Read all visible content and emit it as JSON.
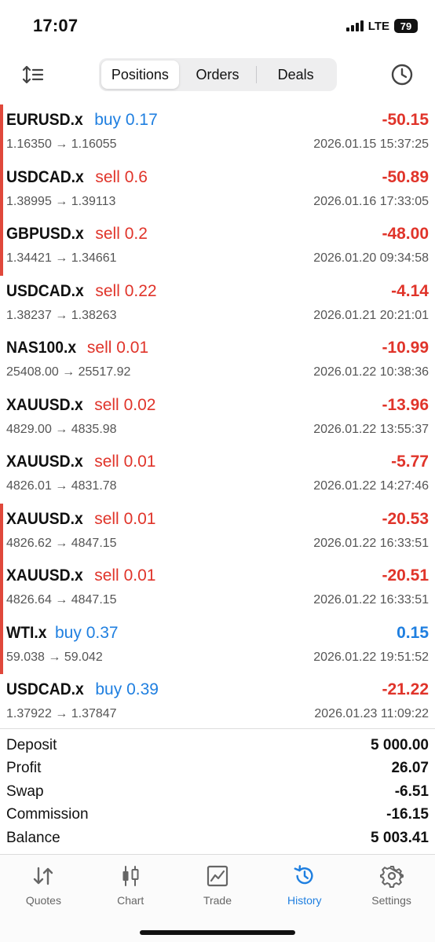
{
  "status": {
    "time": "17:07",
    "network": "LTE",
    "battery": "79"
  },
  "tabs_top": {
    "positions": "Positions",
    "orders": "Orders",
    "deals": "Deals",
    "active": "Positions"
  },
  "trades": [
    {
      "symbol": "EURUSD.x",
      "side": "buy",
      "volume": "0.17",
      "prices": "1.16350 → 1.16055",
      "datetime": "2026.01.15 15:37:25",
      "profit": "-50.15"
    },
    {
      "symbol": "USDCAD.x",
      "side": "sell",
      "volume": "0.6",
      "prices": "1.38995 → 1.39113",
      "datetime": "2026.01.16 17:33:05",
      "profit": "-50.89"
    },
    {
      "symbol": "GBPUSD.x",
      "side": "sell",
      "volume": "0.2",
      "prices": "1.34421 → 1.34661",
      "datetime": "2026.01.20 09:34:58",
      "profit": "-48.00"
    },
    {
      "symbol": "USDCAD.x",
      "side": "sell",
      "volume": "0.22",
      "prices": "1.38237 → 1.38263",
      "datetime": "2026.01.21 20:21:01",
      "profit": "-4.14"
    },
    {
      "symbol": "NAS100.x",
      "side": "sell",
      "volume": "0.01",
      "prices": "25408.00 → 25517.92",
      "datetime": "2026.01.22 10:38:36",
      "profit": "-10.99"
    },
    {
      "symbol": "XAUUSD.x",
      "side": "sell",
      "volume": "0.02",
      "prices": "4829.00 → 4835.98",
      "datetime": "2026.01.22 13:55:37",
      "profit": "-13.96"
    },
    {
      "symbol": "XAUUSD.x",
      "side": "sell",
      "volume": "0.01",
      "prices": "4826.01 → 4831.78",
      "datetime": "2026.01.22 14:27:46",
      "profit": "-5.77"
    },
    {
      "symbol": "XAUUSD.x",
      "side": "sell",
      "volume": "0.01",
      "prices": "4826.62 → 4847.15",
      "datetime": "2026.01.22 16:33:51",
      "profit": "-20.53"
    },
    {
      "symbol": "XAUUSD.x",
      "side": "sell",
      "volume": "0.01",
      "prices": "4826.64 → 4847.15",
      "datetime": "2026.01.22 16:33:51",
      "profit": "-20.51"
    },
    {
      "symbol": "WTI.x",
      "side": "buy",
      "volume": "0.37",
      "prices": "59.038 → 59.042",
      "datetime": "2026.01.22 19:51:52",
      "profit": "0.15"
    },
    {
      "symbol": "USDCAD.x",
      "side": "buy",
      "volume": "0.39",
      "prices": "1.37922 → 1.37847",
      "datetime": "2026.01.23 11:09:22",
      "profit": "-21.22"
    }
  ],
  "summary": [
    {
      "label": "Deposit",
      "value": "5 000.00"
    },
    {
      "label": "Profit",
      "value": "26.07"
    },
    {
      "label": "Swap",
      "value": "-6.51"
    },
    {
      "label": "Commission",
      "value": "-16.15"
    },
    {
      "label": "Balance",
      "value": "5 003.41"
    }
  ],
  "bottom_tabs": [
    {
      "label": "Quotes",
      "icon": "quotes-icon"
    },
    {
      "label": "Chart",
      "icon": "chart-icon"
    },
    {
      "label": "Trade",
      "icon": "trade-icon"
    },
    {
      "label": "History",
      "icon": "history-icon",
      "active": true
    },
    {
      "label": "Settings",
      "icon": "settings-icon"
    }
  ],
  "colors": {
    "buy": "#1f7fe0",
    "sell": "#e0342a",
    "marker": "#e0483b",
    "active_tab": "#1f7fe0"
  }
}
